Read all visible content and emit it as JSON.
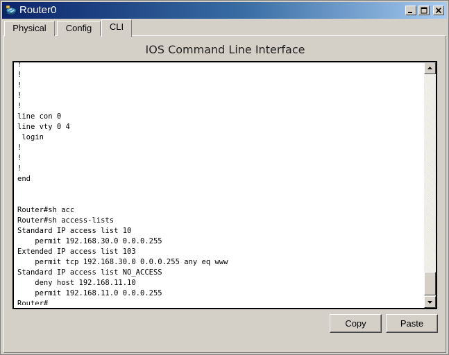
{
  "window": {
    "title": "Router0"
  },
  "tabs": [
    {
      "label": "Physical"
    },
    {
      "label": "Config"
    },
    {
      "label": "CLI"
    }
  ],
  "heading": "IOS Command Line Interface",
  "console_lines": [
    "!",
    "!",
    "!",
    "!",
    "!",
    "line con 0",
    "line vty 0 4",
    " login",
    "!",
    "!",
    "!",
    "end",
    "",
    "",
    "Router#sh acc",
    "Router#sh access-lists",
    "Standard IP access list 10",
    "    permit 192.168.30.0 0.0.0.255",
    "Extended IP access list 103",
    "    permit tcp 192.168.30.0 0.0.0.255 any eq www",
    "Standard IP access list NO_ACCESS",
    "    deny host 192.168.11.10",
    "    permit 192.168.11.0 0.0.0.255",
    "Router#"
  ],
  "buttons": {
    "copy": "Copy",
    "paste": "Paste"
  },
  "icons": {
    "window": "router-icon",
    "minimize": "minimize-icon",
    "maximize": "maximize-icon",
    "close": "close-icon",
    "scroll_up": "arrow-up-icon",
    "scroll_down": "arrow-down-icon"
  }
}
